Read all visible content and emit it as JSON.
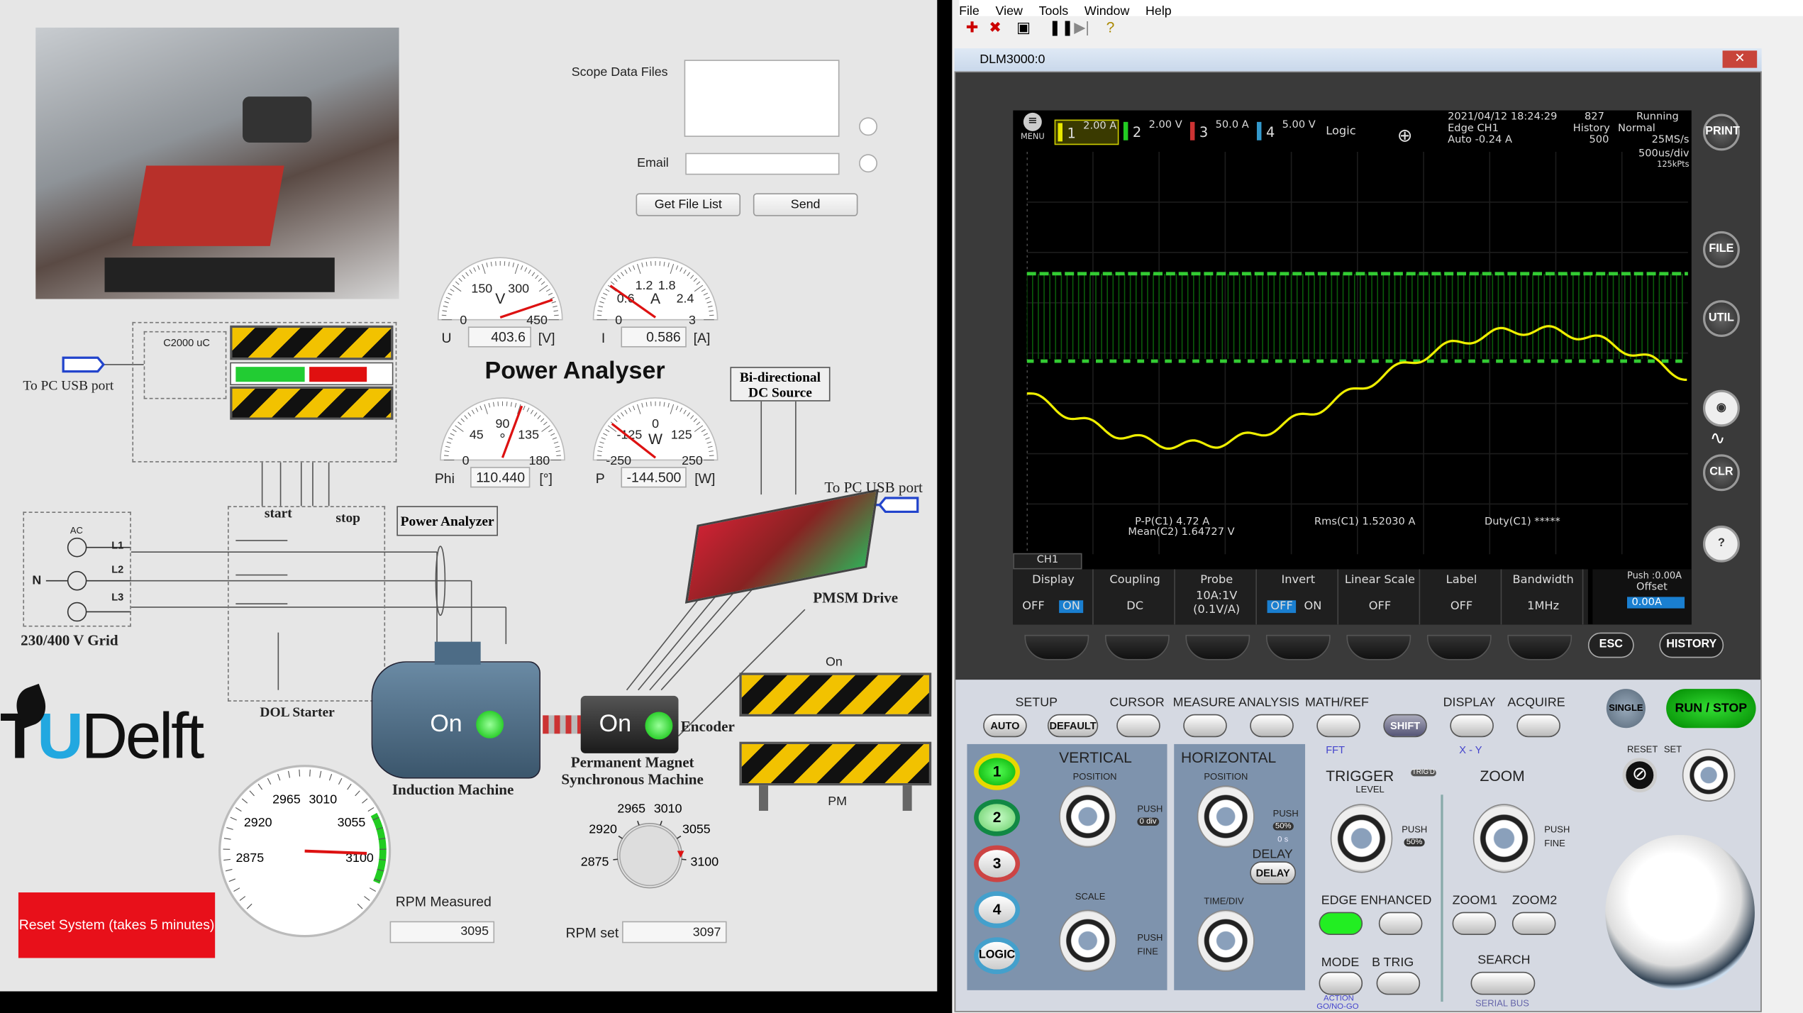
{
  "left": {
    "scope_files_label": "Scope Data Files",
    "email_label": "Email",
    "email_value": "",
    "get_file_list": "Get File List",
    "send": "Send",
    "title": "Power Analyser",
    "gauges": [
      {
        "label": "U",
        "value": "403.6",
        "unit": "[V]",
        "dial_unit": "V",
        "ticks": [
          "0",
          "150",
          "300",
          "450"
        ],
        "reading": 403.6,
        "min": 0,
        "max": 450
      },
      {
        "label": "I",
        "value": "0.586",
        "unit": "[A]",
        "dial_unit": "A",
        "ticks": [
          "0",
          "0.6",
          "1.2",
          "1.8",
          "2.4",
          "3"
        ],
        "reading": 0.586,
        "min": 0,
        "max": 3
      },
      {
        "label": "Phi",
        "value": "110.440",
        "unit": "[°]",
        "dial_unit": "°",
        "ticks": [
          "0",
          "45",
          "90",
          "135",
          "180"
        ],
        "reading": 110.44,
        "min": 0,
        "max": 180
      },
      {
        "label": "P",
        "value": "-144.500",
        "unit": "[W]",
        "dial_unit": "W",
        "ticks": [
          "-250",
          "-125",
          "0",
          "125",
          "250"
        ],
        "reading": -144.5,
        "min": -250,
        "max": 250
      }
    ],
    "diagram": {
      "usb1": "To PC USB port",
      "usb2": "To PC USB port",
      "c2000": "C2000 uC",
      "dc_source": "Bi-directional DC Source",
      "power_analyzer": "Power Analyzer",
      "start": "start",
      "stop": "stop",
      "grid": "230/400 V Grid",
      "dol": "DOL Starter",
      "ac": "AC",
      "n": "N",
      "l1": "L1",
      "l2": "L2",
      "l3": "L3",
      "im": "Induction Machine",
      "im_state": "On",
      "pmsm_state": "On",
      "pmsm": "Permanent Magnet Synchronous Machine",
      "encoder": "Encoder",
      "drive": "PMSM Drive",
      "brake_on": "On",
      "pm": "PM"
    },
    "logo": "TU Delft",
    "rpm_gauge": {
      "ticks": [
        "2875",
        "2920",
        "2965",
        "3010",
        "3055",
        "3100"
      ],
      "reading": 3095,
      "min": 2830,
      "max": 3145
    },
    "rpm_measured_label": "RPM Measured",
    "rpm_measured": "3095",
    "rpm_knob": {
      "ticks": [
        "2875",
        "2920",
        "2965",
        "3010",
        "3055",
        "3100"
      ],
      "setting": 3097
    },
    "rpm_set_label": "RPM set",
    "rpm_set": "3097",
    "reset": "Reset System (takes 5 minutes)",
    "reset_color": "#e8101a"
  },
  "app": {
    "menu": [
      "File",
      "View",
      "Tools",
      "Window",
      "Help"
    ],
    "window_title": "DLM3000:0",
    "scope": {
      "menu_label": "MENU",
      "channels": [
        {
          "n": "1",
          "scale": "2.00 A",
          "color": "#e8e800"
        },
        {
          "n": "2",
          "scale": "2.00 V",
          "color": "#22cc22"
        },
        {
          "n": "3",
          "scale": "50.0 A",
          "color": "#cc3333"
        },
        {
          "n": "4",
          "scale": "5.00 V",
          "color": "#3399cc"
        }
      ],
      "logic": "Logic",
      "datetime": "2021/04/12 18:24:29",
      "count": "827",
      "status": "Running",
      "trigger": "Edge CH1",
      "trigger_level": "Auto -0.24 A",
      "history_label": "History",
      "history": "500",
      "mode": "Normal",
      "rate": "25MS/s",
      "timebase": "500us/div",
      "points": "125kPts",
      "meas": {
        "pp": "P-P(C1)  4.72 A",
        "mean": "Mean(C2)  1.64727 V",
        "rms": "Rms(C1)  1.52030 A",
        "duty": "Duty(C1)  *****"
      },
      "ch_tab": "CH1",
      "softmenu": [
        {
          "title": "Display",
          "a": "OFF",
          "b": "ON",
          "sel": "b"
        },
        {
          "title": "Coupling",
          "a": "DC"
        },
        {
          "title": "Probe",
          "a": "10A:1V",
          "b": "(0.1V/A)"
        },
        {
          "title": "Invert",
          "a": "OFF",
          "b": "ON",
          "sel": "a"
        },
        {
          "title": "Linear Scale",
          "a": "OFF"
        },
        {
          "title": "Label",
          "a": "OFF"
        },
        {
          "title": "Bandwidth",
          "a": "1MHz"
        }
      ],
      "offset_push": "Push :0.00A",
      "offset_label": "Offset",
      "offset_value": "0.00A",
      "side": [
        "PRINT",
        "FILE",
        "UTIL",
        "CLR",
        "?"
      ],
      "esc": "ESC",
      "history_btn": "HISTORY"
    },
    "panel": {
      "setup": "SETUP",
      "auto": "AUTO",
      "default": "DEFAULT",
      "cursor": "CURSOR",
      "measure": "MEASURE",
      "analysis": "ANALYSIS",
      "mathref": "MATH/REF",
      "shift": "SHIFT",
      "display": "DISPLAY",
      "acquire": "ACQUIRE",
      "fft": "FFT",
      "xy": "X - Y",
      "single": "SINGLE",
      "runstop": "RUN / STOP",
      "reset": "RESET",
      "set": "SET",
      "vertical": "VERTICAL",
      "position": "POSITION",
      "push": "PUSH",
      "zero_div": "0 div",
      "scale": "SCALE",
      "fine": "FINE",
      "horizontal": "HORIZONTAL",
      "h_position": "POSITION",
      "fifty": "50%",
      "zero_s": "0 s",
      "delay": "DELAY",
      "timediv": "TIME/DIV",
      "trigger": "TRIGGER",
      "trigd": "TRIG'D",
      "level": "LEVEL",
      "edge_enhanced": "EDGE ENHANCED",
      "mode": "MODE",
      "btrig": "B TRIG",
      "action": "ACTION",
      "gonogo": "GO/NO-GO",
      "zoom": "ZOOM",
      "zoom1": "ZOOM1",
      "zoom2": "ZOOM2",
      "search": "SEARCH",
      "serialbus": "SERIAL BUS",
      "ch_buttons": [
        "1",
        "2",
        "3",
        "4",
        "LOGIC"
      ]
    }
  }
}
